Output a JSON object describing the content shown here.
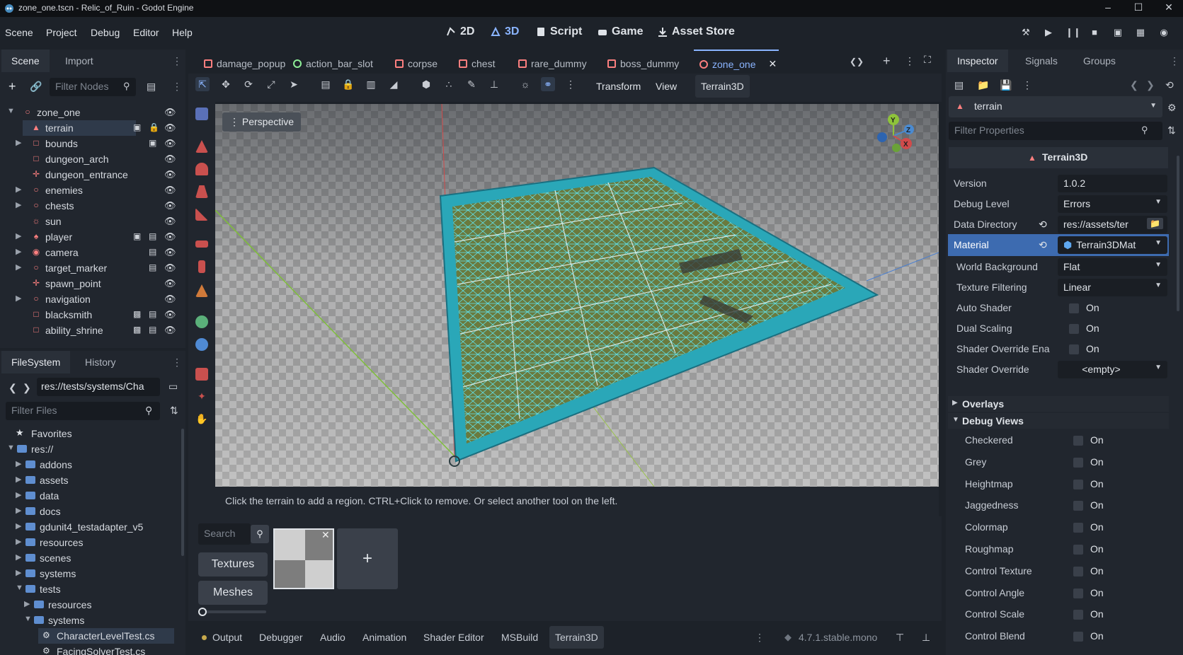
{
  "window": {
    "title": "zone_one.tscn - Relic_of_Ruin - Godot Engine",
    "minimize": "–",
    "maximize": "☐",
    "close": "✕"
  },
  "menu": [
    "Scene",
    "Project",
    "Debug",
    "Editor",
    "Help"
  ],
  "workspaces": [
    {
      "label": "2D",
      "icon": "2d-icon"
    },
    {
      "label": "3D",
      "icon": "3d-icon"
    },
    {
      "label": "Script",
      "icon": "script-icon"
    },
    {
      "label": "Game",
      "icon": "game-icon"
    },
    {
      "label": "Asset Store",
      "icon": "asset-store-icon"
    }
  ],
  "scene_dock": {
    "tabs": [
      "Scene",
      "Import"
    ],
    "filter_placeholder": "Filter Nodes",
    "nodes": [
      {
        "name": "zone_one",
        "icon": "node3d-icon",
        "color": "#fc7f7f"
      },
      {
        "name": "terrain",
        "icon": "terrain-icon",
        "color": "#fc7f7f",
        "selected": true
      },
      {
        "name": "bounds",
        "icon": "area-icon",
        "color": "#fc7f7f"
      },
      {
        "name": "dungeon_arch",
        "icon": "mesh-icon",
        "color": "#fc7f7f"
      },
      {
        "name": "dungeon_entrance",
        "icon": "marker-icon",
        "color": "#fc7f7f"
      },
      {
        "name": "enemies",
        "icon": "node3d-icon",
        "color": "#fc7f7f"
      },
      {
        "name": "chests",
        "icon": "node3d-icon",
        "color": "#fc7f7f"
      },
      {
        "name": "sun",
        "icon": "light-icon",
        "color": "#fc7f7f"
      },
      {
        "name": "player",
        "icon": "character-icon",
        "color": "#fc7f7f"
      },
      {
        "name": "camera",
        "icon": "camera-icon",
        "color": "#fc7f7f"
      },
      {
        "name": "target_marker",
        "icon": "node3d-icon",
        "color": "#fc7f7f"
      },
      {
        "name": "spawn_point",
        "icon": "marker-icon",
        "color": "#fc7f7f"
      },
      {
        "name": "navigation",
        "icon": "node3d-icon",
        "color": "#fc7f7f"
      },
      {
        "name": "blacksmith",
        "icon": "area-icon",
        "color": "#fc7f7f"
      },
      {
        "name": "ability_shrine",
        "icon": "area-icon",
        "color": "#fc7f7f"
      }
    ]
  },
  "filesystem_dock": {
    "tabs": [
      "FileSystem",
      "History"
    ],
    "path": "res://tests/systems/Cha",
    "filter_placeholder": "Filter Files",
    "favorites": "Favorites",
    "root": "res://",
    "items": [
      "addons",
      "assets",
      "data",
      "docs",
      "gdunit4_testadapter_v5",
      "resources",
      "scenes",
      "systems",
      "tests"
    ],
    "tests_children": [
      "resources",
      "systems"
    ],
    "selected_file": "CharacterLevelTest.cs",
    "next_file": "FacingSolverTest.cs"
  },
  "scene_tabs": [
    {
      "label": "damage_popup",
      "color": "#fc7f7f"
    },
    {
      "label": "action_bar_slot",
      "color": "#8eef97"
    },
    {
      "label": "corpse",
      "color": "#fc7f7f"
    },
    {
      "label": "chest",
      "color": "#fc7f7f"
    },
    {
      "label": "rare_dummy",
      "color": "#fc7f7f"
    },
    {
      "label": "boss_dummy",
      "color": "#fc7f7f"
    },
    {
      "label": "zone_one",
      "color": "#fc7f7f",
      "active": true
    }
  ],
  "toolbar": {
    "transform": "Transform",
    "view": "View",
    "terrain": "Terrain3D"
  },
  "viewport": {
    "perspective": "Perspective",
    "hint": "Click the terrain to add a region. CTRL+Click to remove. Or select another tool on the left.",
    "gizmo": {
      "x": "X",
      "y": "Y",
      "z": "Z"
    }
  },
  "asset_panel": {
    "search_placeholder": "Search",
    "textures": "Textures",
    "meshes": "Meshes",
    "add": "+"
  },
  "bottom_tabs": [
    "Output",
    "Debugger",
    "Audio",
    "Animation",
    "Shader Editor",
    "MSBuild",
    "Terrain3D"
  ],
  "version": "4.7.1.stable.mono",
  "inspector": {
    "tabs": [
      "Inspector",
      "Signals",
      "Groups"
    ],
    "object": "terrain",
    "filter_placeholder": "Filter Properties",
    "class_name": "Terrain3D",
    "props": [
      {
        "label": "Version",
        "value": "1.0.2"
      },
      {
        "label": "Debug Level",
        "value": "Errors"
      },
      {
        "label": "Data Directory",
        "value": "res://assets/ter"
      },
      {
        "label": "Material",
        "value": "Terrain3DMat"
      }
    ],
    "material_props": [
      {
        "label": "World Background",
        "value": "Flat"
      },
      {
        "label": "Texture Filtering",
        "value": "Linear"
      },
      {
        "label": "Auto Shader",
        "value": "On"
      },
      {
        "label": "Dual Scaling",
        "value": "On"
      },
      {
        "label": "Shader Override Ena",
        "value": "On"
      },
      {
        "label": "Shader Override",
        "value": "<empty>"
      }
    ],
    "overlays": "Overlays",
    "debug_views": "Debug Views",
    "debug_items": [
      {
        "label": "Checkered",
        "value": "On"
      },
      {
        "label": "Grey",
        "value": "On"
      },
      {
        "label": "Heightmap",
        "value": "On"
      },
      {
        "label": "Jaggedness",
        "value": "On"
      },
      {
        "label": "Colormap",
        "value": "On"
      },
      {
        "label": "Roughmap",
        "value": "On"
      },
      {
        "label": "Control Texture",
        "value": "On"
      },
      {
        "label": "Control Angle",
        "value": "On"
      },
      {
        "label": "Control Scale",
        "value": "On"
      },
      {
        "label": "Control Blend",
        "value": "On"
      }
    ]
  }
}
